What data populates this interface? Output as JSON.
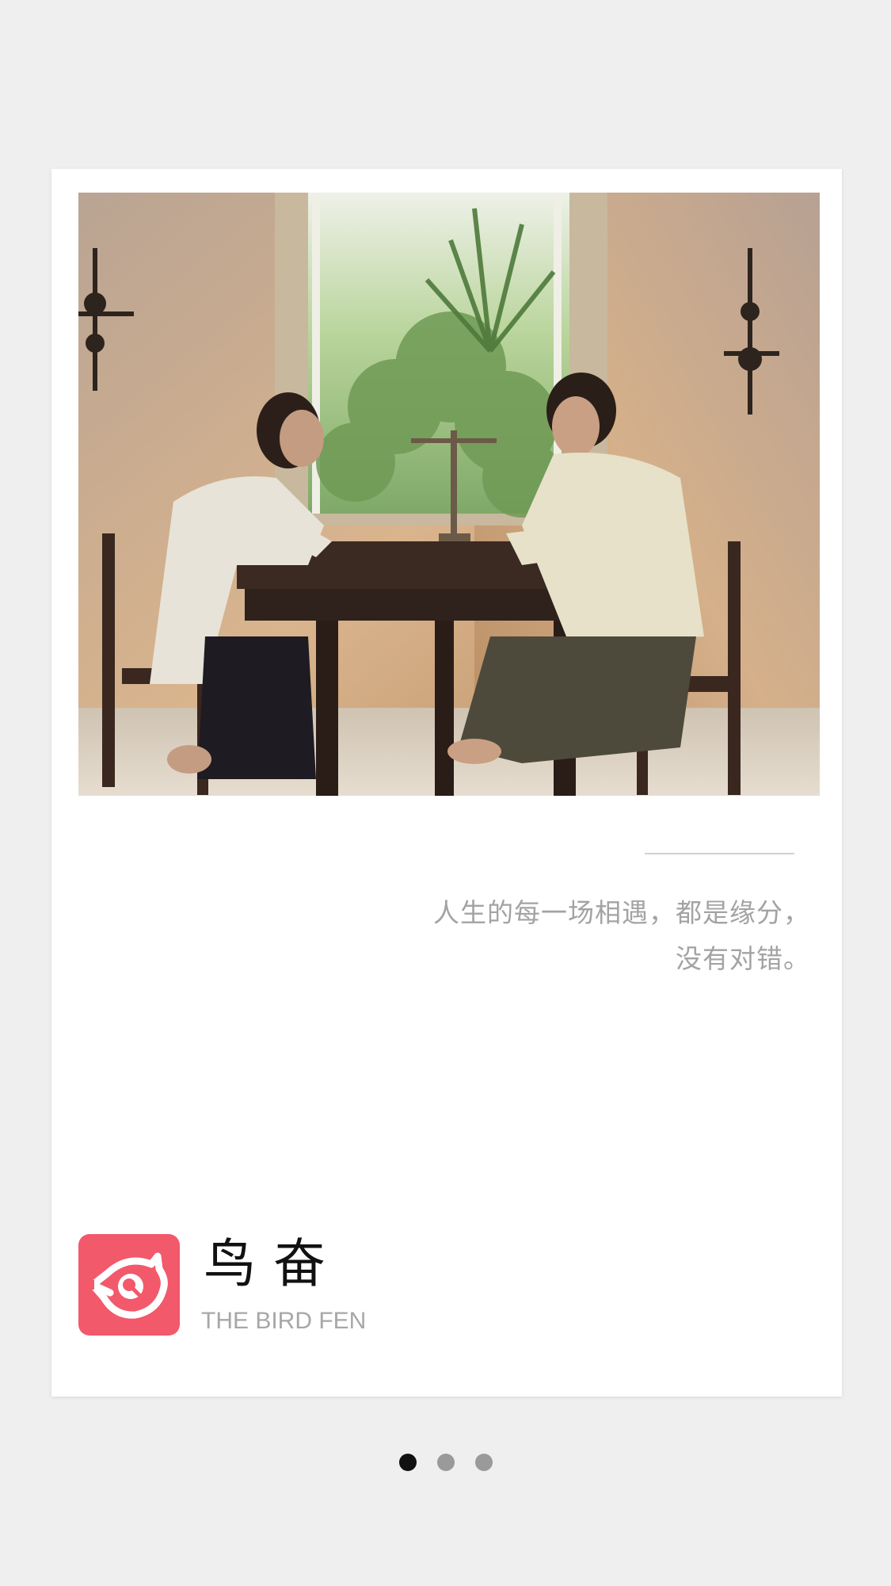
{
  "card": {
    "photo_alt": "",
    "quote_lines": [
      "人生的每一场相遇，都是缘分，",
      "没有对错。"
    ]
  },
  "brand": {
    "name": "鸟奋",
    "subtitle": "THE BIRD FEN",
    "logo_icon": "bird-eye-logo-icon",
    "logo_color": "#f2596b"
  },
  "pager": {
    "count": 3,
    "active_index": 0
  },
  "colors": {
    "background": "#efefef",
    "card": "#ffffff",
    "quote_text": "#a3a3a3",
    "subtitle_text": "#a7a7a7"
  }
}
